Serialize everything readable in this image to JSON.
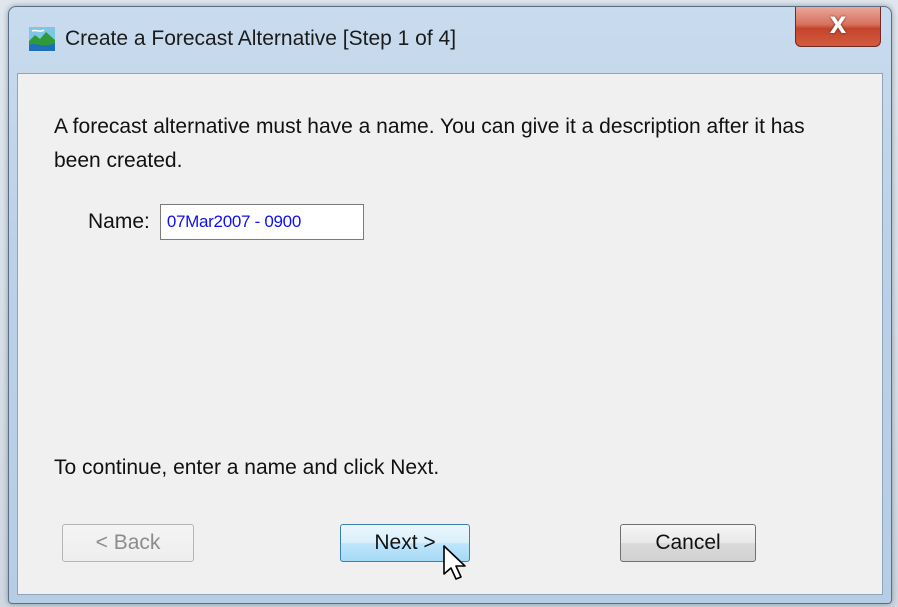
{
  "window": {
    "title": "Create a Forecast Alternative [Step 1 of 4]",
    "close_label": "X",
    "icon": "landscape-app-icon"
  },
  "dialog": {
    "message": "A forecast alternative must have a name. You can give it a description after it has been created.",
    "name_label": "Name:",
    "name_value": "07Mar2007 - 0900",
    "hint": "To continue, enter a name and click Next."
  },
  "buttons": {
    "back_label": "< Back",
    "next_label": "Next >",
    "cancel_label": "Cancel"
  },
  "colors": {
    "input_text": "#1010ee",
    "close_button": "#c4432b",
    "next_button_border": "#3c7fb1"
  }
}
